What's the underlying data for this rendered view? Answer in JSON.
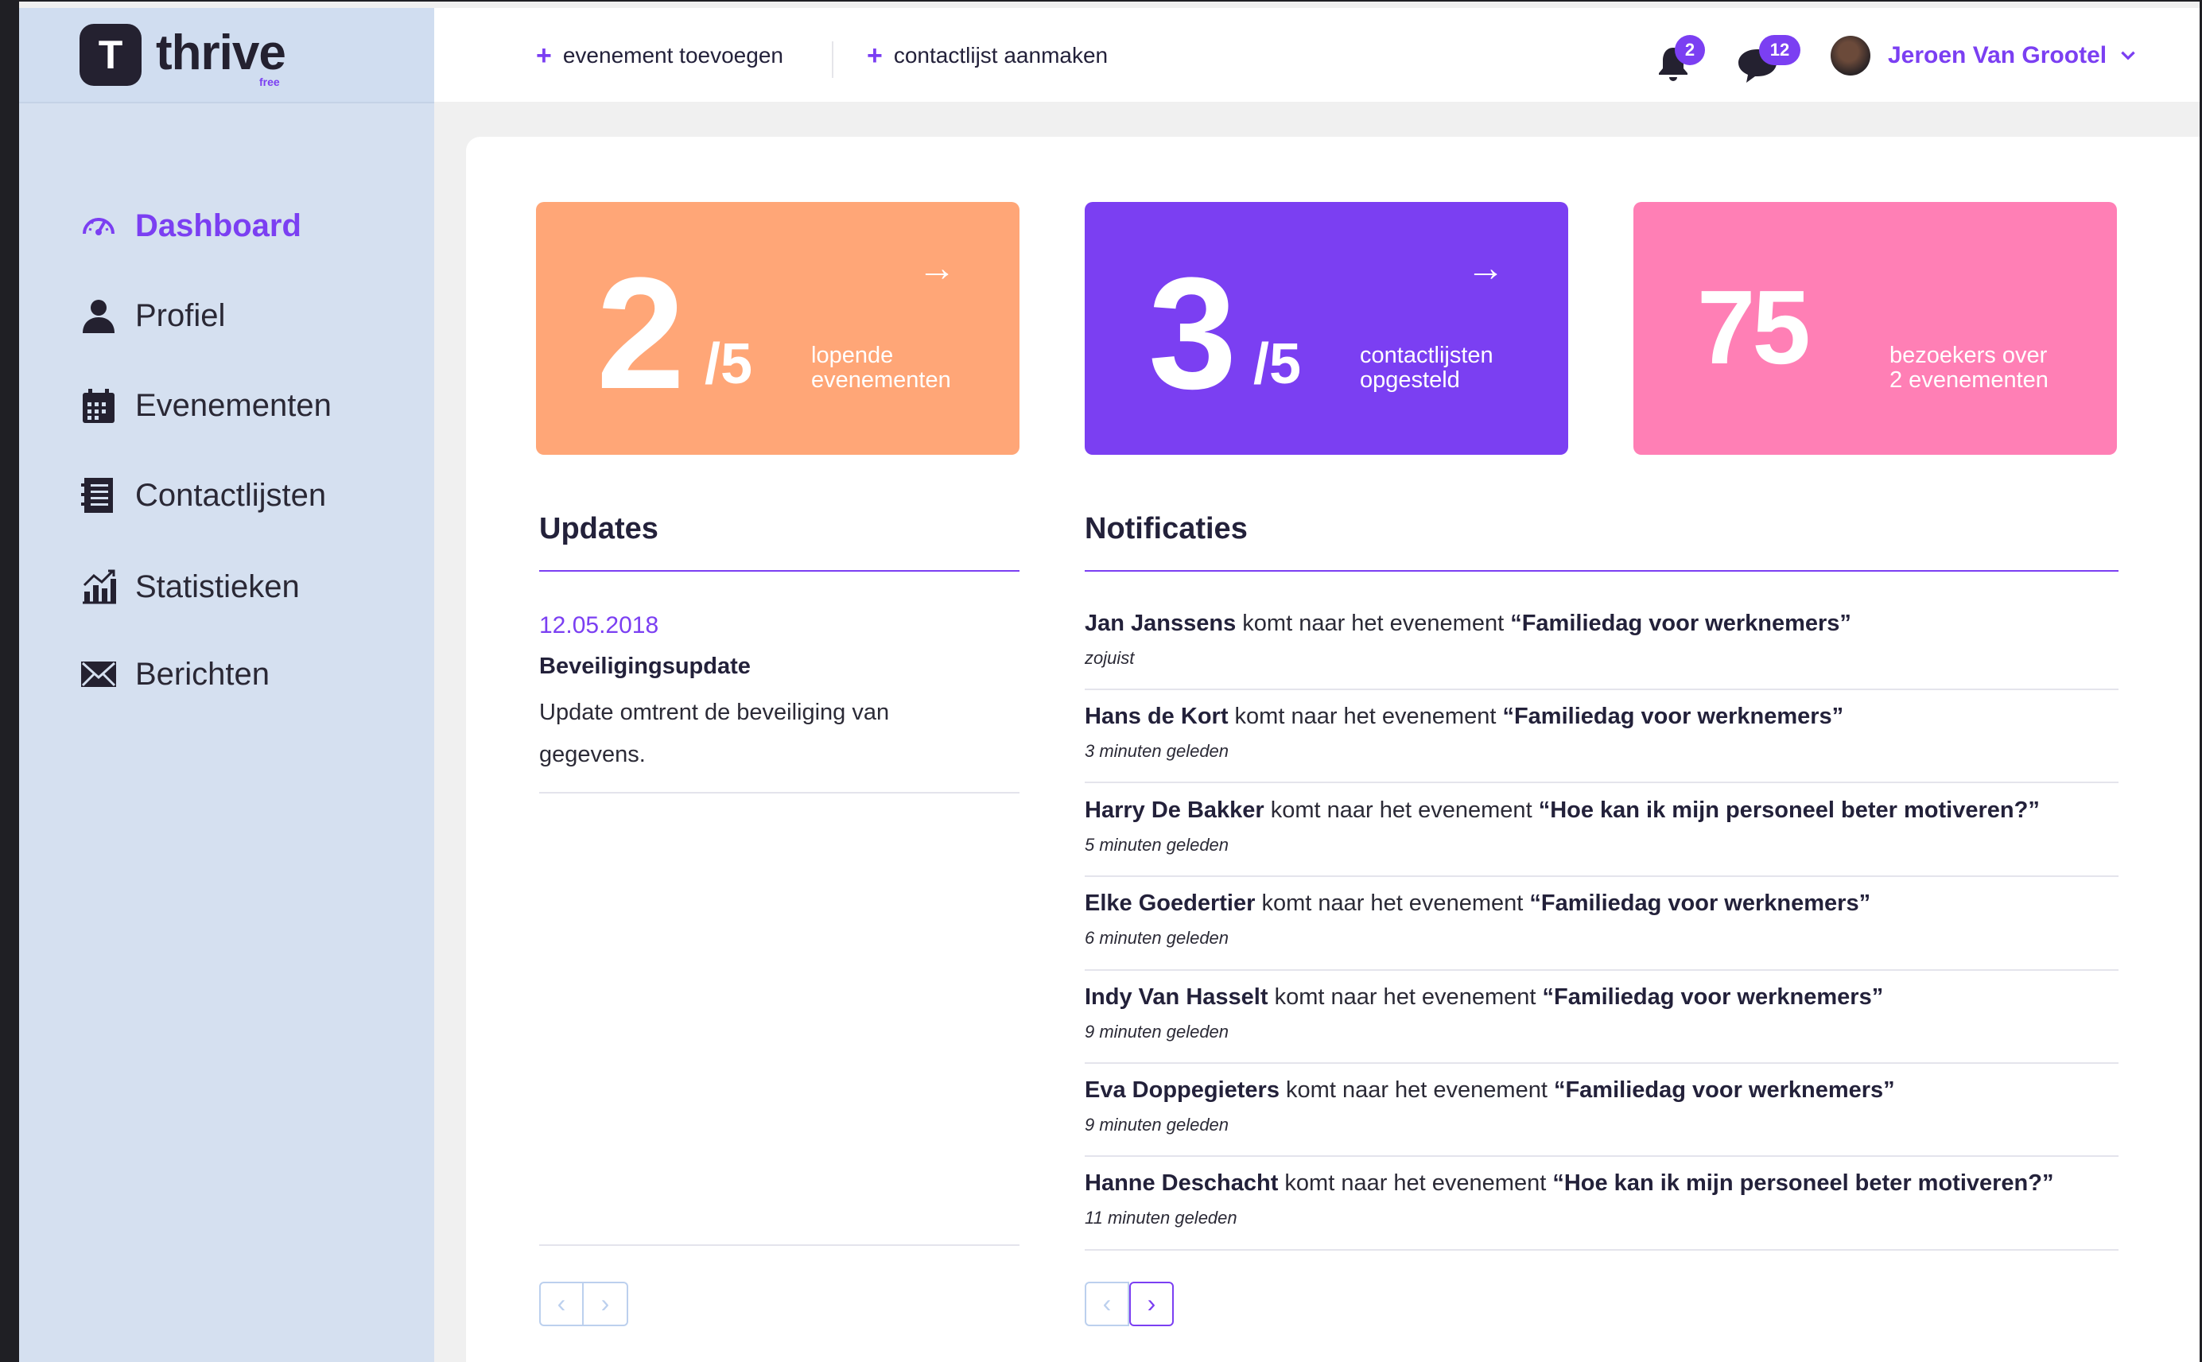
{
  "brand": {
    "name": "thrive",
    "tier": "free",
    "logo_letter": "T"
  },
  "colors": {
    "accent": "#7b3ff2",
    "sidebar": "#d5e0f0",
    "card_orange": "#ffa677",
    "card_purple": "#7b3ff2",
    "card_pink": "#ff7fb5"
  },
  "sidebar": {
    "items": [
      {
        "label": "Dashboard",
        "icon": "speedometer-icon",
        "active": true
      },
      {
        "label": "Profiel",
        "icon": "user-icon",
        "active": false
      },
      {
        "label": "Evenementen",
        "icon": "calendar-icon",
        "active": false
      },
      {
        "label": "Contactlijsten",
        "icon": "list-icon",
        "active": false
      },
      {
        "label": "Statistieken",
        "icon": "chart-icon",
        "active": false
      },
      {
        "label": "Berichten",
        "icon": "envelope-icon",
        "active": false
      }
    ]
  },
  "topbar": {
    "add_event": "evenement toevoegen",
    "add_list": "contactlijst aanmaken",
    "plus": "+",
    "notifications_count": "2",
    "messages_count": "12",
    "user_name": "Jeroen Van Grootel"
  },
  "stats": [
    {
      "value": "2",
      "total": "/5",
      "desc_line1": "lopende",
      "desc_line2": "evenementen",
      "arrow": "→"
    },
    {
      "value": "3",
      "total": "/5",
      "desc_line1": "contactlijsten",
      "desc_line2": "opgesteld",
      "arrow": "→"
    },
    {
      "value": "75",
      "desc_line1": "bezoekers over",
      "desc_line2": "2 evenementen"
    }
  ],
  "updates": {
    "title": "Updates",
    "item": {
      "date": "12.05.2018",
      "title": "Beveiligingsupdate",
      "body": "Update omtrent de beveiliging van gegevens."
    }
  },
  "notifications": {
    "title": "Notificaties",
    "verb": "komt naar het evenement",
    "items": [
      {
        "name": "Jan Janssens",
        "event": "“Familiedag voor werknemers”",
        "time": "zojuist"
      },
      {
        "name": "Hans de Kort",
        "event": "“Familiedag voor werknemers”",
        "time": "3 minuten geleden"
      },
      {
        "name": "Harry De Bakker",
        "event": "“Hoe kan ik mijn personeel beter motiveren?”",
        "time": "5 minuten geleden"
      },
      {
        "name": "Elke Goedertier",
        "event": "“Familiedag voor werknemers”",
        "time": "6 minuten geleden"
      },
      {
        "name": "Indy Van Hasselt",
        "event": "“Familiedag voor werknemers”",
        "time": "9 minuten geleden"
      },
      {
        "name": "Eva Doppegieters",
        "event": "“Familiedag voor werknemers”",
        "time": "9 minuten geleden"
      },
      {
        "name": "Hanne Deschacht",
        "event": "“Hoe kan ik mijn personeel beter motiveren?”",
        "time": "11 minuten geleden"
      }
    ]
  },
  "pager": {
    "prev": "‹",
    "next": "›"
  }
}
